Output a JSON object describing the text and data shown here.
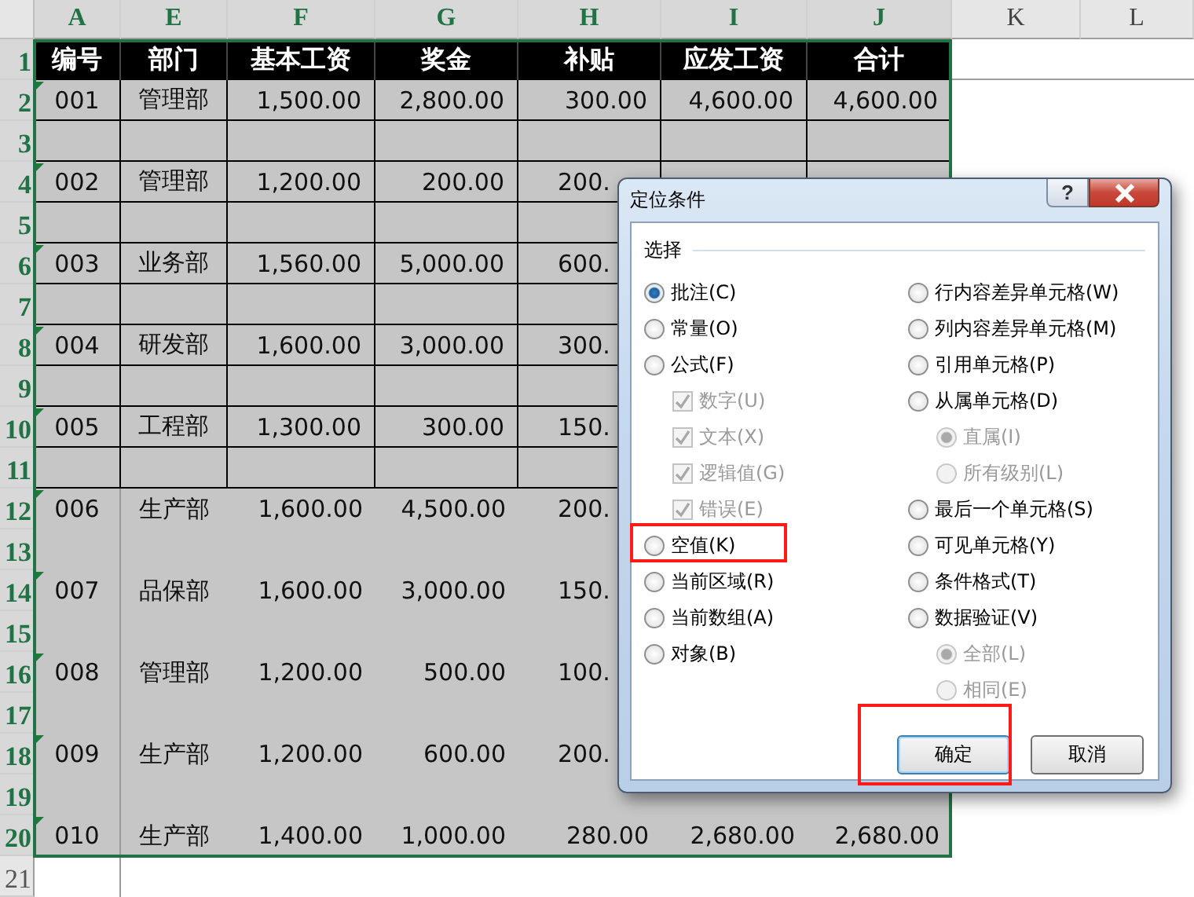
{
  "sheet": {
    "column_headers": [
      {
        "label": "A",
        "selected": true
      },
      {
        "label": "E",
        "selected": true
      },
      {
        "label": "F",
        "selected": true
      },
      {
        "label": "G",
        "selected": true
      },
      {
        "label": "H",
        "selected": true
      },
      {
        "label": "I",
        "selected": true
      },
      {
        "label": "J",
        "selected": true
      },
      {
        "label": "K",
        "selected": false
      },
      {
        "label": "L",
        "selected": false
      }
    ],
    "rows": [
      {
        "header": "1",
        "selected": true,
        "kind": "title",
        "cells": [
          "编号",
          "部门",
          "基本工资",
          "奖金",
          "补贴",
          "应发工资",
          "合计"
        ]
      },
      {
        "header": "2",
        "selected": true,
        "kind": "boxed",
        "cells": [
          "001",
          "管理部",
          "1,500.00",
          "2,800.00",
          "300.00",
          "4,600.00",
          "4,600.00"
        ]
      },
      {
        "header": "3",
        "selected": true,
        "kind": "boxed",
        "cells": []
      },
      {
        "header": "4",
        "selected": true,
        "kind": "boxed",
        "cells": [
          "002",
          "管理部",
          "1,200.00",
          "200.00",
          "200."
        ]
      },
      {
        "header": "5",
        "selected": true,
        "kind": "boxed",
        "cells": []
      },
      {
        "header": "6",
        "selected": true,
        "kind": "boxed",
        "cells": [
          "003",
          "业务部",
          "1,560.00",
          "5,000.00",
          "600."
        ]
      },
      {
        "header": "7",
        "selected": true,
        "kind": "boxed",
        "cells": []
      },
      {
        "header": "8",
        "selected": true,
        "kind": "boxed",
        "cells": [
          "004",
          "研发部",
          "1,600.00",
          "3,000.00",
          "300."
        ]
      },
      {
        "header": "9",
        "selected": true,
        "kind": "boxed",
        "cells": []
      },
      {
        "header": "10",
        "selected": true,
        "kind": "boxed",
        "cells": [
          "005",
          "工程部",
          "1,300.00",
          "300.00",
          "150."
        ]
      },
      {
        "header": "11",
        "selected": true,
        "kind": "boxed",
        "cells": []
      },
      {
        "header": "12",
        "selected": true,
        "kind": "plain",
        "cells": [
          "006",
          "生产部",
          "1,600.00",
          "4,500.00",
          "200."
        ]
      },
      {
        "header": "13",
        "selected": true,
        "kind": "plain",
        "cells": []
      },
      {
        "header": "14",
        "selected": true,
        "kind": "plain",
        "cells": [
          "007",
          "品保部",
          "1,600.00",
          "3,000.00",
          "150."
        ]
      },
      {
        "header": "15",
        "selected": true,
        "kind": "plain",
        "cells": []
      },
      {
        "header": "16",
        "selected": true,
        "kind": "plain",
        "cells": [
          "008",
          "管理部",
          "1,200.00",
          "500.00",
          "100."
        ]
      },
      {
        "header": "17",
        "selected": true,
        "kind": "plain",
        "cells": []
      },
      {
        "header": "18",
        "selected": true,
        "kind": "plain",
        "cells": [
          "009",
          "生产部",
          "1,200.00",
          "600.00",
          "200."
        ]
      },
      {
        "header": "19",
        "selected": true,
        "kind": "plain",
        "cells": []
      },
      {
        "header": "20",
        "selected": true,
        "kind": "plain",
        "cells": [
          "010",
          "生产部",
          "1,400.00",
          "1,000.00",
          "280.00",
          "2,680.00",
          "2,680.00"
        ]
      },
      {
        "header": "21",
        "selected": false,
        "kind": "outside",
        "cells": []
      }
    ]
  },
  "dialog": {
    "title": "定位条件",
    "help_button": "?",
    "group_label": "选择",
    "left_options": [
      {
        "label": "批注(C)",
        "kind": "radio",
        "selected": true,
        "disabled": false,
        "highlighted": false
      },
      {
        "label": "常量(O)",
        "kind": "radio",
        "selected": false,
        "disabled": false,
        "highlighted": false
      },
      {
        "label": "公式(F)",
        "kind": "radio",
        "selected": false,
        "disabled": false,
        "highlighted": false,
        "children": [
          {
            "label": "数字(U)",
            "kind": "checkbox",
            "checked": true,
            "disabled": true,
            "highlighted": false
          },
          {
            "label": "文本(X)",
            "kind": "checkbox",
            "checked": true,
            "disabled": true,
            "highlighted": false
          },
          {
            "label": "逻辑值(G)",
            "kind": "checkbox",
            "checked": true,
            "disabled": true,
            "highlighted": false
          },
          {
            "label": "错误(E)",
            "kind": "checkbox",
            "checked": true,
            "disabled": true,
            "highlighted": false
          }
        ]
      },
      {
        "label": "空值(K)",
        "kind": "radio",
        "selected": false,
        "disabled": false,
        "highlighted": true
      },
      {
        "label": "当前区域(R)",
        "kind": "radio",
        "selected": false,
        "disabled": false,
        "highlighted": false
      },
      {
        "label": "当前数组(A)",
        "kind": "radio",
        "selected": false,
        "disabled": false,
        "highlighted": false
      },
      {
        "label": "对象(B)",
        "kind": "radio",
        "selected": false,
        "disabled": false,
        "highlighted": false
      }
    ],
    "right_options": [
      {
        "label": "行内容差异单元格(W)",
        "kind": "radio",
        "selected": false,
        "disabled": false,
        "highlighted": false
      },
      {
        "label": "列内容差异单元格(M)",
        "kind": "radio",
        "selected": false,
        "disabled": false,
        "highlighted": false
      },
      {
        "label": "引用单元格(P)",
        "kind": "radio",
        "selected": false,
        "disabled": false,
        "highlighted": false
      },
      {
        "label": "从属单元格(D)",
        "kind": "radio",
        "selected": false,
        "disabled": false,
        "highlighted": false,
        "children": [
          {
            "label": "直属(I)",
            "kind": "radio",
            "selected": true,
            "disabled": true,
            "highlighted": false
          },
          {
            "label": "所有级别(L)",
            "kind": "radio",
            "selected": false,
            "disabled": true,
            "highlighted": false
          }
        ]
      },
      {
        "label": "最后一个单元格(S)",
        "kind": "radio",
        "selected": false,
        "disabled": false,
        "highlighted": false
      },
      {
        "label": "可见单元格(Y)",
        "kind": "radio",
        "selected": false,
        "disabled": false,
        "highlighted": false
      },
      {
        "label": "条件格式(T)",
        "kind": "radio",
        "selected": false,
        "disabled": false,
        "highlighted": false
      },
      {
        "label": "数据验证(V)",
        "kind": "radio",
        "selected": false,
        "disabled": false,
        "highlighted": false,
        "children": [
          {
            "label": "全部(L)",
            "kind": "radio",
            "selected": true,
            "disabled": true,
            "highlighted": false
          },
          {
            "label": "相同(E)",
            "kind": "radio",
            "selected": false,
            "disabled": true,
            "highlighted": false
          }
        ]
      }
    ],
    "buttons": [
      {
        "label": "确定",
        "default": true,
        "highlighted": true
      },
      {
        "label": "取消",
        "default": false,
        "highlighted": false
      }
    ]
  }
}
